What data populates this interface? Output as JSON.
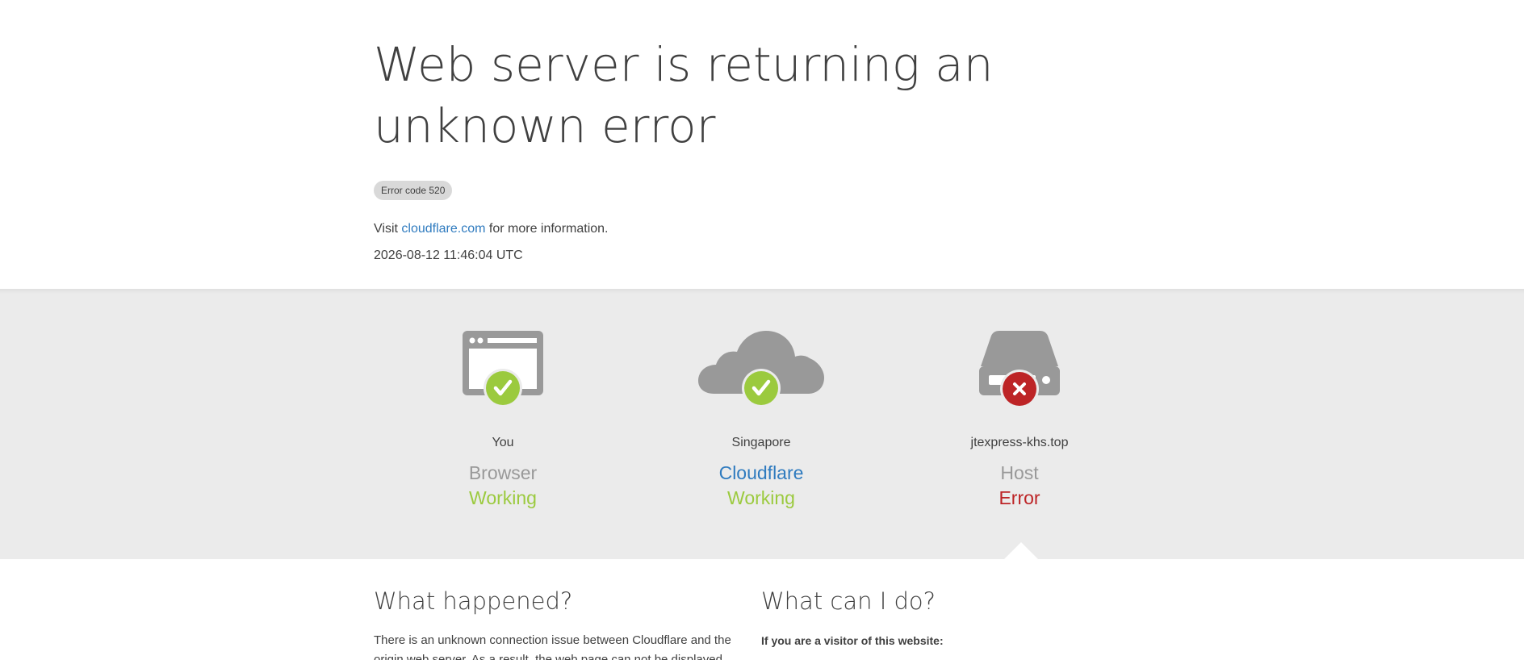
{
  "header": {
    "title": "Web server is returning an unknown error",
    "error_code": "Error code 520",
    "visit_prefix": "Visit",
    "visit_link": "cloudflare.com",
    "visit_suffix": "for more information.",
    "timestamp": "2026-08-12 11:46:04 UTC"
  },
  "status": [
    {
      "icon": "browser-icon",
      "badge": "check-icon",
      "location": "You",
      "role": "Browser",
      "state": "Working"
    },
    {
      "icon": "cloud-icon",
      "badge": "check-icon",
      "location": "Singapore",
      "role": "Cloudflare",
      "state": "Working"
    },
    {
      "icon": "server-icon",
      "badge": "x-icon",
      "location": "jtexpress-khs.top",
      "role": "Host",
      "state": "Error"
    }
  ],
  "sections": {
    "what_happened_title": "What happened?",
    "what_happened_body": "There is an unknown connection issue between Cloudflare and the origin web server. As a result, the web page can not be displayed.",
    "what_can_i_do_title": "What can I do?",
    "visitor_heading": "If you are a visitor of this website:"
  },
  "colors": {
    "ok": "#9bca3e",
    "error": "#bd2426",
    "link": "#2f7bbf",
    "icon_gray": "#999999",
    "band": "#ebebeb"
  }
}
